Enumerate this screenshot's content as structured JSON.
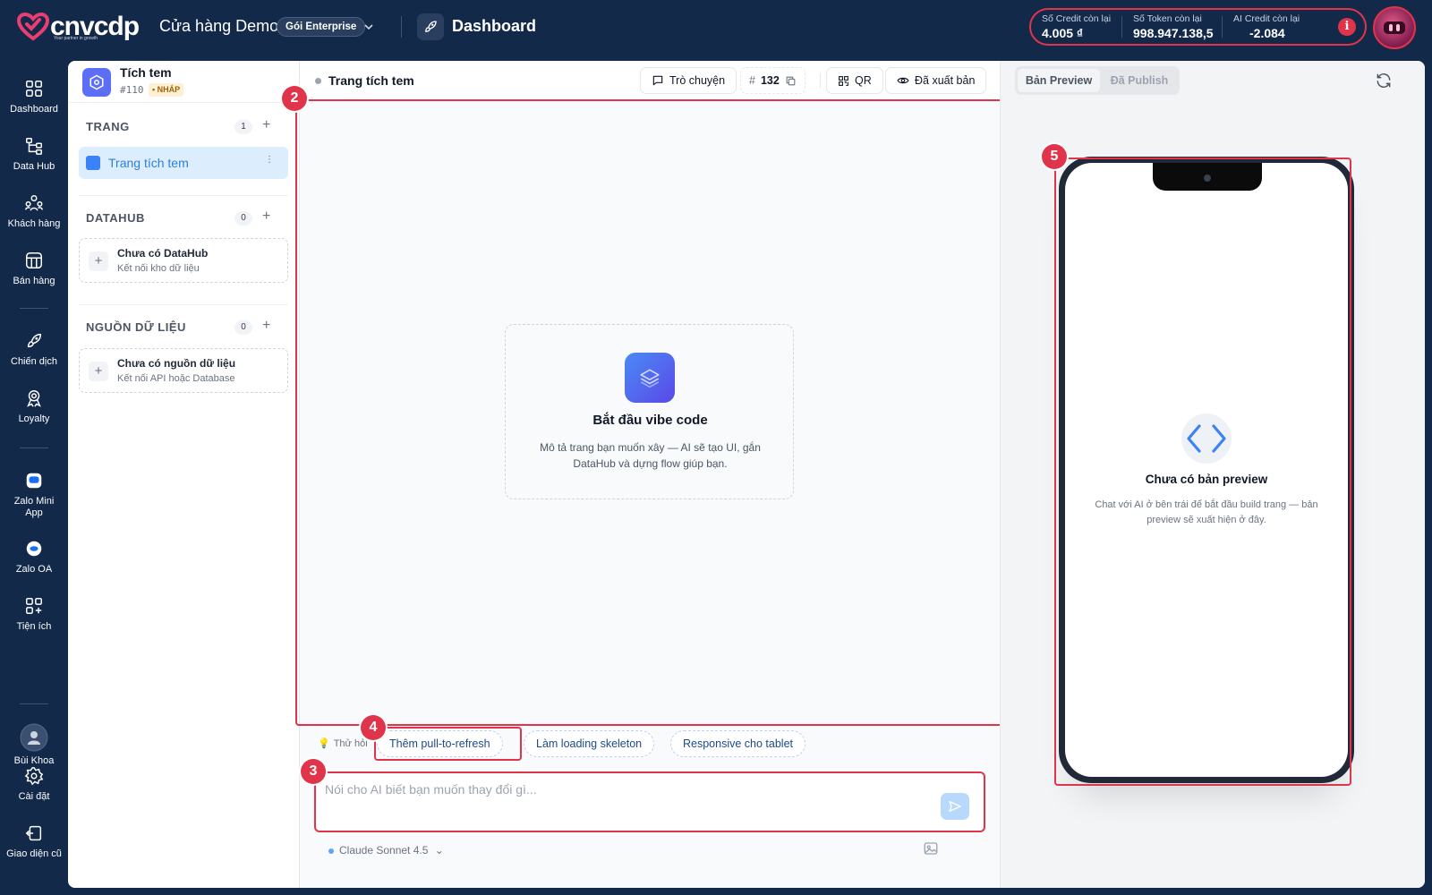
{
  "brand": {
    "logo_text": "cnvcdp",
    "tagline": "Your partner in growth"
  },
  "header": {
    "store_name": "Cửa hàng Demo",
    "plan_badge": "Gói Enterprise",
    "page_title": "Dashboard",
    "credits": [
      {
        "label": "Số Credit còn lại",
        "value": "4.005 ₫"
      },
      {
        "label": "Số Token còn lại",
        "value": "998.947.138,5"
      },
      {
        "label": "AI Credit còn lại",
        "value": "-2.084"
      }
    ],
    "info_icon": "i"
  },
  "nav": {
    "items": [
      {
        "label": "Dashboard",
        "icon": "grid-icon"
      },
      {
        "label": "Data Hub",
        "icon": "hierarchy-icon"
      },
      {
        "label": "Khách hàng",
        "icon": "users-icon"
      },
      {
        "label": "Bán hàng",
        "icon": "store-icon"
      },
      {
        "label": "Chiến dịch",
        "icon": "rocket-icon"
      },
      {
        "label": "Loyalty",
        "icon": "badge-icon"
      },
      {
        "label": "Zalo Mini App",
        "icon": "zalo-icon"
      },
      {
        "label": "Zalo OA",
        "icon": "zalo-oa-icon"
      },
      {
        "label": "Tiện ích",
        "icon": "apps-icon"
      }
    ],
    "user_label": "Bùi Khoa",
    "settings_label": "Cài đặt",
    "legacy_label": "Giao diện cũ"
  },
  "project": {
    "name": "Tích tem",
    "id": "#110",
    "status": "• NHÁP",
    "sections": {
      "pages": {
        "title": "TRANG",
        "count": "1",
        "add": "+",
        "item": "Trang tích tem",
        "more": "⋮"
      },
      "datahub": {
        "title": "DATAHUB",
        "count": "0",
        "add": "+",
        "empty_title": "Chưa có DataHub",
        "empty_desc": "Kết nối kho dữ liệu",
        "plus": "+"
      },
      "sources": {
        "title": "NGUỒN DỮ LIỆU",
        "count": "0",
        "add": "+",
        "empty_title": "Chưa có nguồn dữ liệu",
        "empty_desc": "Kết nối API hoặc Database",
        "plus": "+"
      }
    }
  },
  "editor": {
    "page_title": "Trang tích tem",
    "chat_button": "Trò chuyện",
    "hash": "#",
    "number": "132",
    "qr_button": "QR",
    "published_button": "Đã xuất bản",
    "start_title": "Bắt đầu vibe code",
    "start_desc": "Mô tả trang bạn muốn xây — AI sẽ tạo UI, gắn DataHub và dựng flow giúp bạn.",
    "suggest_label": "Thử hỏi",
    "suggestions": [
      "Thêm pull-to-refresh",
      "Làm loading skeleton",
      "Responsive cho tablet"
    ],
    "input_placeholder": "Nói cho AI biết bạn muốn thay đổi gì...",
    "model": "Claude Sonnet 4.5",
    "model_chevron": "⌄"
  },
  "preview": {
    "tab_preview": "Bản Preview",
    "tab_publish": "Đã Publish",
    "empty_title": "Chưa có bản preview",
    "empty_desc": "Chat với AI ở bên trái để bắt đầu build trang — bản preview sẽ xuất hiện ở đây."
  },
  "markers": [
    "2",
    "3",
    "4",
    "5"
  ],
  "colors": {
    "navy": "#12294a",
    "highlight": "#e0344b",
    "accent_blue": "#3b82f6",
    "chip_text": "#1e4a8a"
  }
}
